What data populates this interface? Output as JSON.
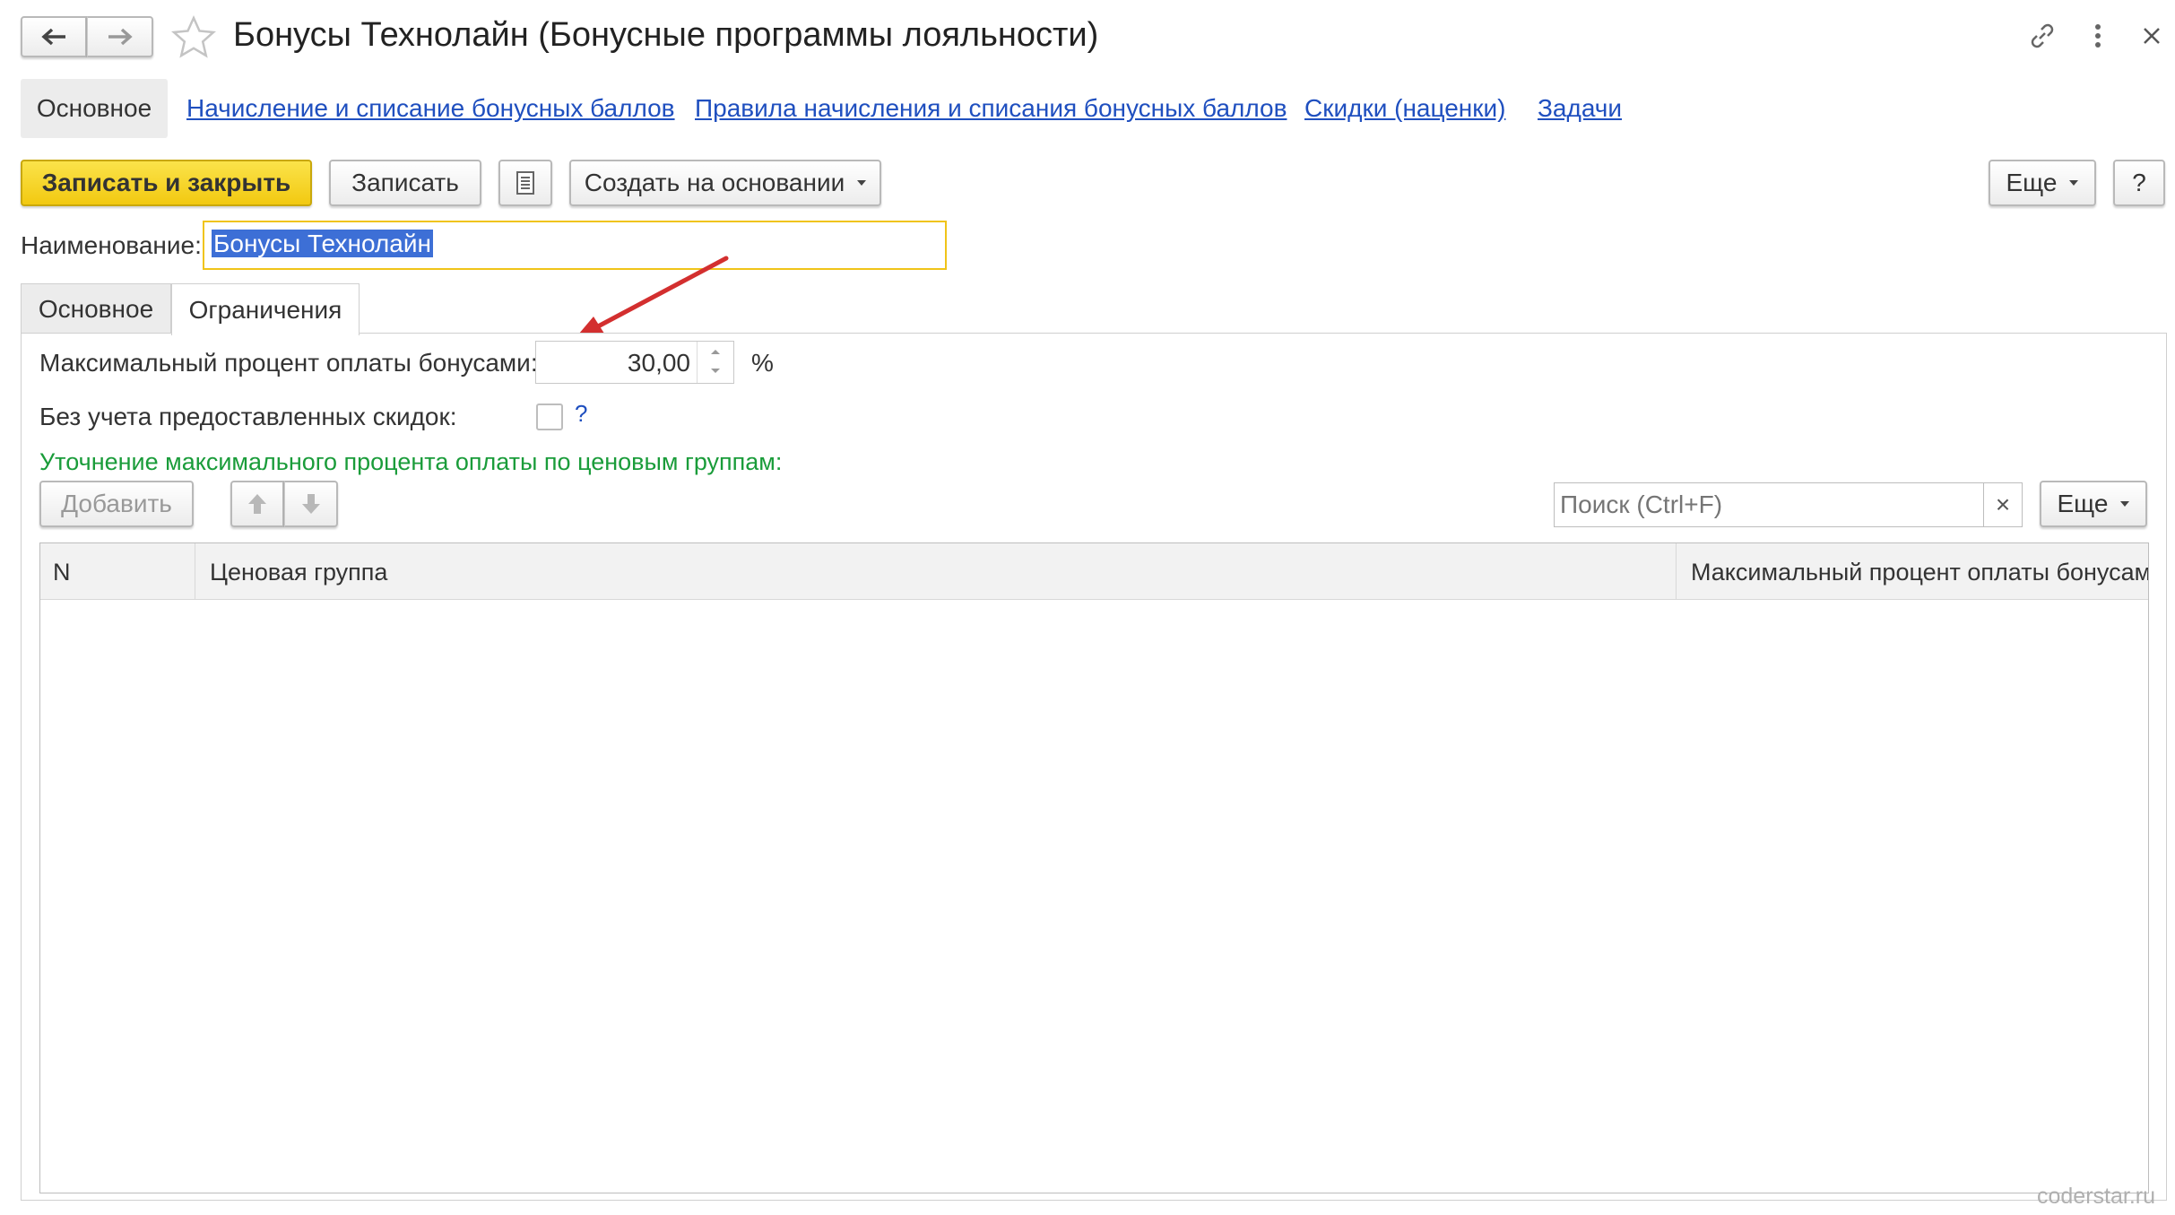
{
  "window": {
    "title": "Бонусы Технолайн (Бонусные программы лояльности)"
  },
  "nav_links": {
    "main": "Основное",
    "accrual": "Начисление и списание бонусных баллов",
    "rules": "Правила начисления и списания бонусных баллов",
    "discounts": "Скидки (наценки)",
    "tasks": "Задачи"
  },
  "toolbar": {
    "save_close": "Записать и закрыть",
    "save": "Записать",
    "create_based": "Создать на основании",
    "more": "Еще",
    "help": "?"
  },
  "form": {
    "name_label": "Наименование:",
    "name_value": "Бонусы Технолайн"
  },
  "tabs": {
    "main": "Основное",
    "limits": "Ограничения"
  },
  "limits": {
    "max_percent_label": "Максимальный процент оплаты бонусами:",
    "max_percent_value": "30,00",
    "percent_unit": "%",
    "no_discounts_label": "Без учета предоставленных скидок:",
    "no_discounts_checked": false,
    "help_mark": "?",
    "section_title": "Уточнение максимального процента оплаты по ценовым группам:",
    "section_color": "#1a9c3a"
  },
  "table_toolbar": {
    "add": "Добавить",
    "search_placeholder": "Поиск (Ctrl+F)",
    "clear": "×",
    "more": "Еще"
  },
  "table": {
    "columns": [
      "N",
      "Ценовая группа",
      "Максимальный процент оплаты бонусами"
    ],
    "rows": []
  },
  "watermark": "coderstar.ru",
  "colors": {
    "accent_yellow": "#f5d327",
    "link_blue": "#1f4fbf",
    "arrow_red": "#d32f2f",
    "selection_blue": "#3d6fd6"
  }
}
